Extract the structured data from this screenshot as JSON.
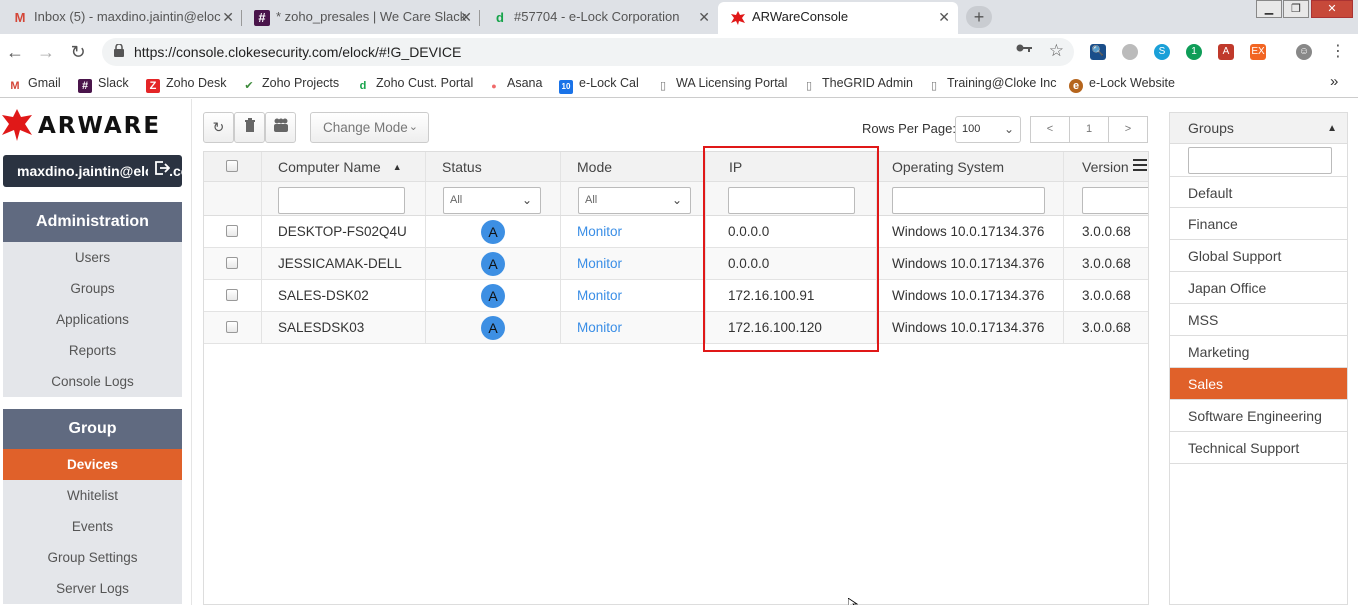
{
  "browser": {
    "tabs": [
      {
        "title": "Inbox (5) - maxdino.jaintin@eloc",
        "icon": "gmail-icon",
        "color": "#d44638"
      },
      {
        "title": "* zoho_presales | We Care Slack",
        "icon": "slack-icon",
        "color": "#4a154b"
      },
      {
        "title": "#57704 - e-Lock Corporation",
        "icon": "zoho-desk-icon",
        "color": "#16a34a"
      },
      {
        "title": "ARWareConsole",
        "icon": "arware-icon",
        "color": "#e01818"
      }
    ],
    "url": "https://console.clokesecurity.com/elock/#!G_DEVICE",
    "bookmarks": [
      {
        "label": "Gmail",
        "color": "#d44638",
        "glyph": "M"
      },
      {
        "label": "Slack",
        "color": "#4a154b",
        "glyph": "#"
      },
      {
        "label": "Zoho Desk",
        "color": "#e42527",
        "glyph": "Z"
      },
      {
        "label": "Zoho Projects",
        "color": "#3c8a3a",
        "glyph": "✔"
      },
      {
        "label": "Zoho Cust. Portal",
        "color": "#16a34a",
        "glyph": "d"
      },
      {
        "label": "Asana",
        "color": "#f06a6a",
        "glyph": "●"
      },
      {
        "label": "e-Lock Cal",
        "color": "#1a73e8",
        "glyph": "10"
      },
      {
        "label": "WA Licensing Portal",
        "color": "#777",
        "glyph": "▯"
      },
      {
        "label": "TheGRID Admin",
        "color": "#777",
        "glyph": "▯"
      },
      {
        "label": "Training@Cloke Inc",
        "color": "#777",
        "glyph": "▯"
      },
      {
        "label": "e-Lock Website",
        "color": "#b5651d",
        "glyph": "e"
      }
    ],
    "more": "»"
  },
  "app": {
    "brand": "ARWARE",
    "user": "maxdino.jaintin@elock.com",
    "admin_section": {
      "title": "Administration",
      "items": [
        "Users",
        "Groups",
        "Applications",
        "Reports",
        "Console Logs"
      ]
    },
    "group_section": {
      "title": "Group",
      "items": [
        "Devices",
        "Whitelist",
        "Events",
        "Group Settings",
        "Server Logs"
      ],
      "active": "Devices"
    },
    "toolbar": {
      "change_mode": "Change Mode",
      "rows_per_page_label": "Rows Per Page:",
      "rows_per_page": "100",
      "prev": "<",
      "page": "1",
      "next": ">"
    },
    "table": {
      "columns": [
        "Computer Name",
        "Status",
        "Mode",
        "IP",
        "Operating System",
        "Version"
      ],
      "filter_all": "All",
      "rows": [
        {
          "name": "DESKTOP-FS02Q4U",
          "status": "A",
          "mode": "Monitor",
          "ip": "0.0.0.0",
          "os": "Windows 10.0.17134.376",
          "version": "3.0.0.68"
        },
        {
          "name": "JESSICAMAK-DELL",
          "status": "A",
          "mode": "Monitor",
          "ip": "0.0.0.0",
          "os": "Windows 10.0.17134.376",
          "version": "3.0.0.68"
        },
        {
          "name": "SALES-DSK02",
          "status": "A",
          "mode": "Monitor",
          "ip": "172.16.100.91",
          "os": "Windows 10.0.17134.376",
          "version": "3.0.0.68"
        },
        {
          "name": "SALESDSK03",
          "status": "A",
          "mode": "Monitor",
          "ip": "172.16.100.120",
          "os": "Windows 10.0.17134.376",
          "version": "3.0.0.68"
        }
      ]
    },
    "groups_panel": {
      "title": "Groups",
      "items": [
        "Default",
        "Finance",
        "Global Support",
        "Japan Office",
        "MSS",
        "Marketing",
        "Sales",
        "Software Engineering",
        "Technical Support"
      ],
      "active": "Sales"
    },
    "colors": {
      "accent": "#e0612a",
      "nav_header": "#606a80",
      "user_bg": "#2b3341",
      "link": "#3a8ee6",
      "highlight": "#e01818"
    }
  }
}
